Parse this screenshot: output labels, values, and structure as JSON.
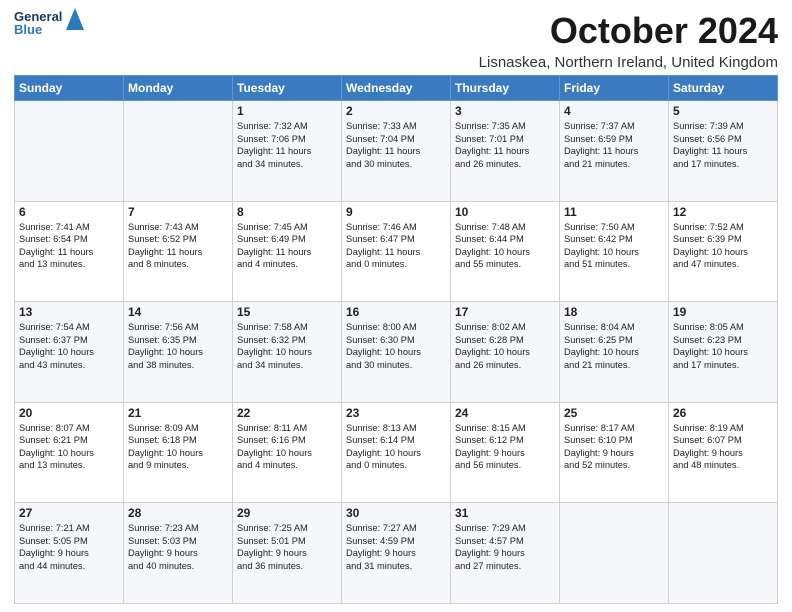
{
  "header": {
    "logo_line1": "General",
    "logo_line2": "Blue",
    "month": "October 2024",
    "location": "Lisnaskea, Northern Ireland, United Kingdom"
  },
  "days_of_week": [
    "Sunday",
    "Monday",
    "Tuesday",
    "Wednesday",
    "Thursday",
    "Friday",
    "Saturday"
  ],
  "weeks": [
    [
      {
        "day": "",
        "content": ""
      },
      {
        "day": "",
        "content": ""
      },
      {
        "day": "1",
        "content": "Sunrise: 7:32 AM\nSunset: 7:06 PM\nDaylight: 11 hours\nand 34 minutes."
      },
      {
        "day": "2",
        "content": "Sunrise: 7:33 AM\nSunset: 7:04 PM\nDaylight: 11 hours\nand 30 minutes."
      },
      {
        "day": "3",
        "content": "Sunrise: 7:35 AM\nSunset: 7:01 PM\nDaylight: 11 hours\nand 26 minutes."
      },
      {
        "day": "4",
        "content": "Sunrise: 7:37 AM\nSunset: 6:59 PM\nDaylight: 11 hours\nand 21 minutes."
      },
      {
        "day": "5",
        "content": "Sunrise: 7:39 AM\nSunset: 6:56 PM\nDaylight: 11 hours\nand 17 minutes."
      }
    ],
    [
      {
        "day": "6",
        "content": "Sunrise: 7:41 AM\nSunset: 6:54 PM\nDaylight: 11 hours\nand 13 minutes."
      },
      {
        "day": "7",
        "content": "Sunrise: 7:43 AM\nSunset: 6:52 PM\nDaylight: 11 hours\nand 8 minutes."
      },
      {
        "day": "8",
        "content": "Sunrise: 7:45 AM\nSunset: 6:49 PM\nDaylight: 11 hours\nand 4 minutes."
      },
      {
        "day": "9",
        "content": "Sunrise: 7:46 AM\nSunset: 6:47 PM\nDaylight: 11 hours\nand 0 minutes."
      },
      {
        "day": "10",
        "content": "Sunrise: 7:48 AM\nSunset: 6:44 PM\nDaylight: 10 hours\nand 55 minutes."
      },
      {
        "day": "11",
        "content": "Sunrise: 7:50 AM\nSunset: 6:42 PM\nDaylight: 10 hours\nand 51 minutes."
      },
      {
        "day": "12",
        "content": "Sunrise: 7:52 AM\nSunset: 6:39 PM\nDaylight: 10 hours\nand 47 minutes."
      }
    ],
    [
      {
        "day": "13",
        "content": "Sunrise: 7:54 AM\nSunset: 6:37 PM\nDaylight: 10 hours\nand 43 minutes."
      },
      {
        "day": "14",
        "content": "Sunrise: 7:56 AM\nSunset: 6:35 PM\nDaylight: 10 hours\nand 38 minutes."
      },
      {
        "day": "15",
        "content": "Sunrise: 7:58 AM\nSunset: 6:32 PM\nDaylight: 10 hours\nand 34 minutes."
      },
      {
        "day": "16",
        "content": "Sunrise: 8:00 AM\nSunset: 6:30 PM\nDaylight: 10 hours\nand 30 minutes."
      },
      {
        "day": "17",
        "content": "Sunrise: 8:02 AM\nSunset: 6:28 PM\nDaylight: 10 hours\nand 26 minutes."
      },
      {
        "day": "18",
        "content": "Sunrise: 8:04 AM\nSunset: 6:25 PM\nDaylight: 10 hours\nand 21 minutes."
      },
      {
        "day": "19",
        "content": "Sunrise: 8:05 AM\nSunset: 6:23 PM\nDaylight: 10 hours\nand 17 minutes."
      }
    ],
    [
      {
        "day": "20",
        "content": "Sunrise: 8:07 AM\nSunset: 6:21 PM\nDaylight: 10 hours\nand 13 minutes."
      },
      {
        "day": "21",
        "content": "Sunrise: 8:09 AM\nSunset: 6:18 PM\nDaylight: 10 hours\nand 9 minutes."
      },
      {
        "day": "22",
        "content": "Sunrise: 8:11 AM\nSunset: 6:16 PM\nDaylight: 10 hours\nand 4 minutes."
      },
      {
        "day": "23",
        "content": "Sunrise: 8:13 AM\nSunset: 6:14 PM\nDaylight: 10 hours\nand 0 minutes."
      },
      {
        "day": "24",
        "content": "Sunrise: 8:15 AM\nSunset: 6:12 PM\nDaylight: 9 hours\nand 56 minutes."
      },
      {
        "day": "25",
        "content": "Sunrise: 8:17 AM\nSunset: 6:10 PM\nDaylight: 9 hours\nand 52 minutes."
      },
      {
        "day": "26",
        "content": "Sunrise: 8:19 AM\nSunset: 6:07 PM\nDaylight: 9 hours\nand 48 minutes."
      }
    ],
    [
      {
        "day": "27",
        "content": "Sunrise: 7:21 AM\nSunset: 5:05 PM\nDaylight: 9 hours\nand 44 minutes."
      },
      {
        "day": "28",
        "content": "Sunrise: 7:23 AM\nSunset: 5:03 PM\nDaylight: 9 hours\nand 40 minutes."
      },
      {
        "day": "29",
        "content": "Sunrise: 7:25 AM\nSunset: 5:01 PM\nDaylight: 9 hours\nand 36 minutes."
      },
      {
        "day": "30",
        "content": "Sunrise: 7:27 AM\nSunset: 4:59 PM\nDaylight: 9 hours\nand 31 minutes."
      },
      {
        "day": "31",
        "content": "Sunrise: 7:29 AM\nSunset: 4:57 PM\nDaylight: 9 hours\nand 27 minutes."
      },
      {
        "day": "",
        "content": ""
      },
      {
        "day": "",
        "content": ""
      }
    ]
  ]
}
